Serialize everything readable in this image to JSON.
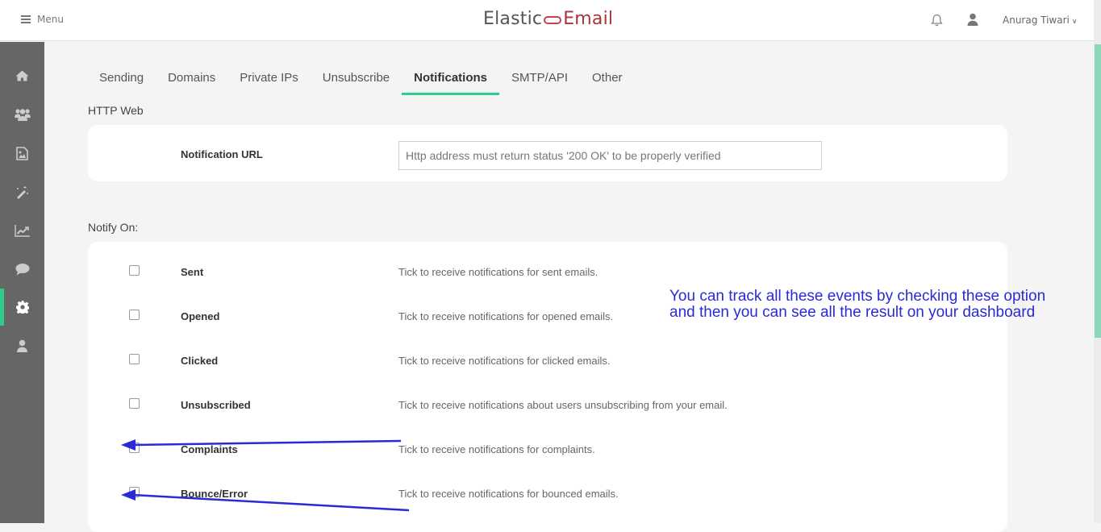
{
  "header": {
    "menu_label": "Menu",
    "logo": {
      "part1": "Elastic",
      "part2": "Email"
    },
    "user_name": "Anurag Tiwari",
    "icons": [
      "bell-icon",
      "user-icon",
      "chevron-down-icon"
    ]
  },
  "sidebar": {
    "items": [
      {
        "name": "home",
        "icon": "home-icon",
        "active": false
      },
      {
        "name": "contacts",
        "icon": "users-icon",
        "active": false
      },
      {
        "name": "templates",
        "icon": "image-file-icon",
        "active": false
      },
      {
        "name": "campaigns",
        "icon": "magic-wand-icon",
        "active": false
      },
      {
        "name": "reports",
        "icon": "chart-icon",
        "active": false
      },
      {
        "name": "chat",
        "icon": "chat-bubble-icon",
        "active": false
      },
      {
        "name": "settings",
        "icon": "gear-icon",
        "active": true
      },
      {
        "name": "account",
        "icon": "user-icon",
        "active": false
      }
    ],
    "accent_color": "#2dcc8a"
  },
  "tabs": [
    {
      "label": "Sending",
      "active": false
    },
    {
      "label": "Domains",
      "active": false
    },
    {
      "label": "Private IPs",
      "active": false
    },
    {
      "label": "Unsubscribe",
      "active": false
    },
    {
      "label": "Notifications",
      "active": true
    },
    {
      "label": "SMTP/API",
      "active": false
    },
    {
      "label": "Other",
      "active": false
    }
  ],
  "http_web": {
    "section_title": "HTTP Web",
    "field_label": "Notification URL",
    "input_value": "",
    "input_placeholder": "Http address must return status '200 OK' to be properly verified"
  },
  "notify_on": {
    "section_title": "Notify On:",
    "options": [
      {
        "label": "Sent",
        "description": "Tick to receive notifications for sent emails.",
        "checked": false
      },
      {
        "label": "Opened",
        "description": "Tick to receive notifications for opened emails.",
        "checked": false
      },
      {
        "label": "Clicked",
        "description": "Tick to receive notifications for clicked emails.",
        "checked": false
      },
      {
        "label": "Unsubscribed",
        "description": "Tick to receive notifications about users unsubscribing from your email.",
        "checked": false
      },
      {
        "label": "Complaints",
        "description": "Tick to receive notifications for complaints.",
        "checked": false
      },
      {
        "label": "Bounce/Error",
        "description": "Tick to receive notifications for bounced emails.",
        "checked": false
      }
    ]
  },
  "annotation": {
    "line1": "You can track all these events by checking these option",
    "line2": "and then you can see all the result on your dashboard",
    "color": "#2a2ad6"
  }
}
